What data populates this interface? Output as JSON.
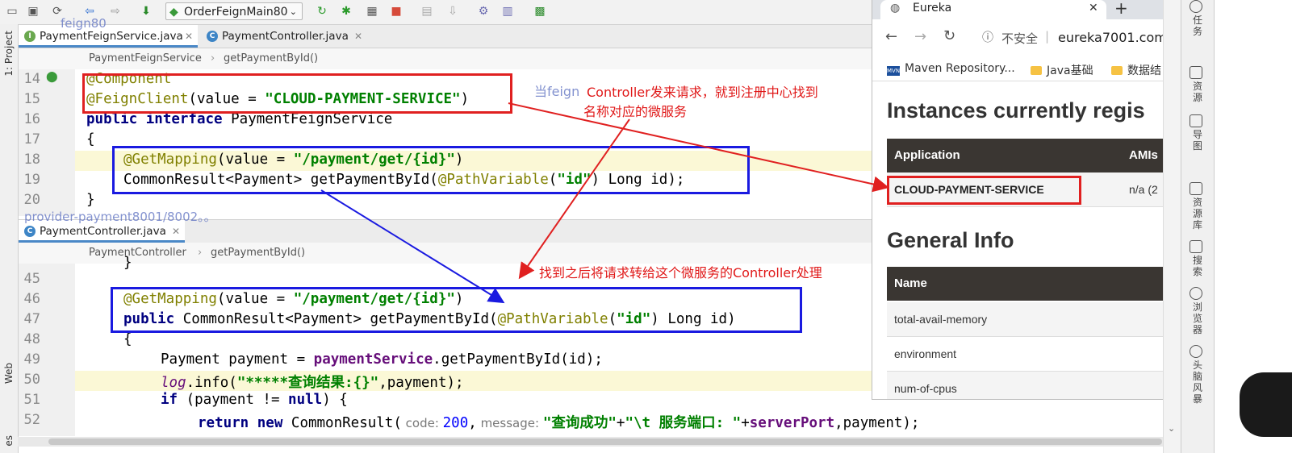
{
  "toolbar": {
    "run_config": "OrderFeignMain80"
  },
  "left_strip": {
    "project_label": "1: Project",
    "web_label": "Web",
    "bottom_label": "es"
  },
  "editor_top": {
    "tabs": [
      {
        "label": "PaymentFeignService.java",
        "icon": "I",
        "active": true
      },
      {
        "label": "PaymentController.java",
        "icon": "C",
        "active": false
      }
    ],
    "breadcrumb": [
      "PaymentFeignService",
      "getPaymentById()"
    ],
    "line_numbers": [
      "14",
      "15",
      "16",
      "17",
      "18",
      "19",
      "20"
    ]
  },
  "editor_bottom": {
    "tab": {
      "label": "PaymentController.java",
      "icon": "C"
    },
    "breadcrumb": [
      "PaymentController",
      "getPaymentById()"
    ],
    "line_numbers": [
      "45",
      "46",
      "47",
      "48",
      "49",
      "50",
      "51",
      "52"
    ]
  },
  "code": {
    "l14": "@Component",
    "l15_ann": "@FeignClient",
    "l15_open": "(value = ",
    "l15_str": "\"CLOUD-PAYMENT-SERVICE\"",
    "l15_close": ")",
    "l16_kw": "public interface ",
    "l16_name": "PaymentFeignService",
    "l17": "{",
    "l18_ann": "@GetMapping",
    "l18_open": "(value = ",
    "l18_str": "\"/payment/get/{id}\"",
    "l18_close": ")",
    "l19_a": "CommonResult<Payment> getPaymentById(",
    "l19_ann": "@PathVariable",
    "l19_b": "(",
    "l19_str": "\"id\"",
    "l19_c": ") Long id);",
    "l20": "}",
    "l45": "}",
    "l46_ann": "@GetMapping",
    "l46_open": "(value = ",
    "l46_str": "\"/payment/get/{id}\"",
    "l46_close": ")",
    "l47_kw": "public ",
    "l47_a": "CommonResult<Payment> getPaymentById(",
    "l47_ann": "@PathVariable",
    "l47_b": "(",
    "l47_str": "\"id\"",
    "l47_c": ") Long id)",
    "l48": "{",
    "l49_a": "Payment payment = ",
    "l49_fld": "paymentService",
    "l49_b": ".getPaymentById(id);",
    "l50_log": "log",
    "l50_a": ".info(",
    "l50_str": "\"*****查询结果:{}\"",
    "l50_b": ",payment);",
    "l51_kw": "if ",
    "l51_a": "(payment != ",
    "l51_null": "null",
    "l51_b": ") {",
    "l52_kw": "return new ",
    "l52_a": "CommonResult(",
    "l52_hint1": " code: ",
    "l52_num": "200",
    "l52_b": ",",
    "l52_hint2": " message: ",
    "l52_str": "\"查询成功\"",
    "l52_c": "+",
    "l52_str2": "\"\\t 服务端口: \"",
    "l52_d": "+",
    "l52_fld": "serverPort",
    "l52_e": ",payment);"
  },
  "overlays": {
    "feign80": "feign80",
    "provider": "provider-payment8001/8002。。",
    "dang_feign": "当feign"
  },
  "annotations": {
    "note1_line1": "Controller发来请求，就到注册中心找到",
    "note1_line2": "名称对应的微服务",
    "note2": "找到之后将请求转给这个微服务的Controller处理"
  },
  "browser": {
    "tab_title": "Eureka",
    "security_label": "不安全",
    "url": "eureka7001.com",
    "bookmarks": [
      "Maven Repository...",
      "Java基础",
      "数据结"
    ],
    "heading_instances": "Instances currently regis",
    "instances_header": {
      "application": "Application",
      "amis": "AMIs"
    },
    "instance_row": {
      "application": "CLOUD-PAYMENT-SERVICE",
      "amis": "n/a (2"
    },
    "heading_general": "General Info",
    "general_header": "Name",
    "general_rows": [
      "total-avail-memory",
      "environment",
      "num-of-cpus"
    ]
  },
  "right_strip": {
    "labels": [
      "任务",
      "资源",
      "导图",
      "资源库",
      "搜索",
      "浏览器",
      "头脑风暴"
    ]
  },
  "colors": {
    "annotation_red": "#e02020",
    "annotation_blue": "#1a1ae0",
    "code_string": "#008000",
    "code_annotation": "#808000",
    "code_keyword": "#000080",
    "eureka_header": "#3a3632"
  }
}
